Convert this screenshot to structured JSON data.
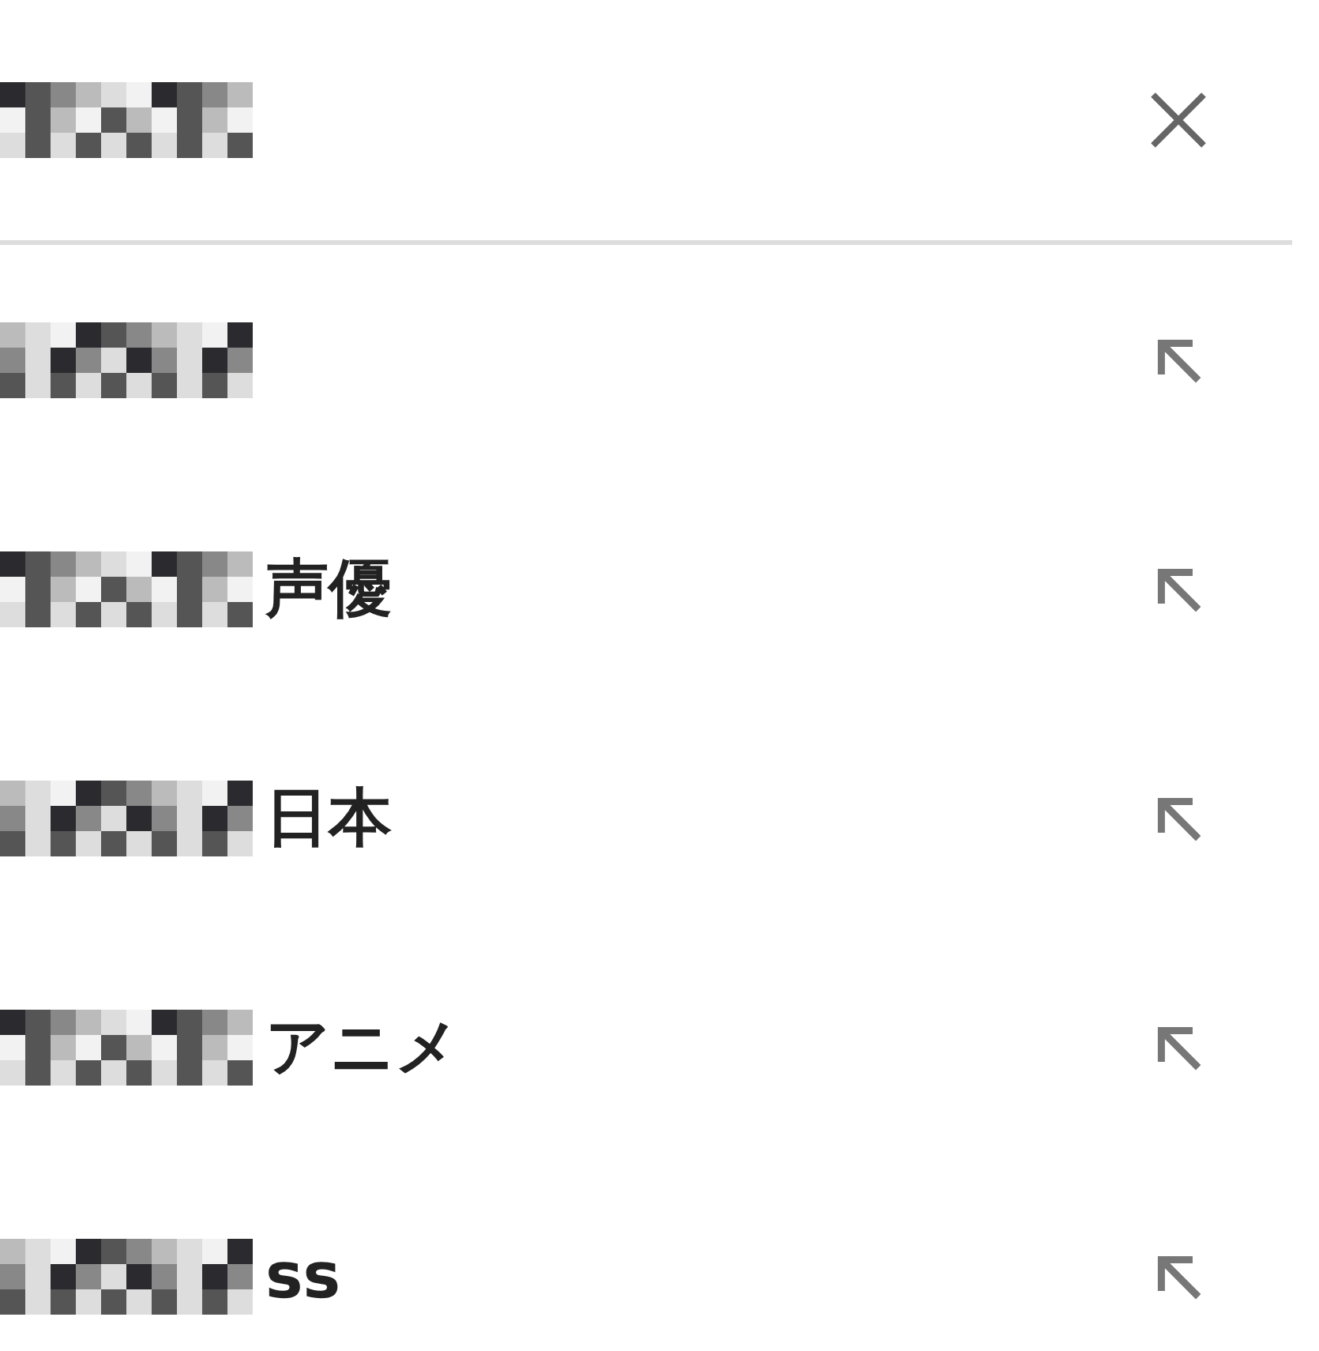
{
  "search": {
    "redacted": true
  },
  "suggestions": [
    {
      "redacted": true
    },
    {
      "redacted": true,
      "text": "声優"
    },
    {
      "redacted": true,
      "text": "日本"
    },
    {
      "redacted": true,
      "text": "アニメ"
    },
    {
      "redacted": true,
      "text": "ss"
    }
  ]
}
